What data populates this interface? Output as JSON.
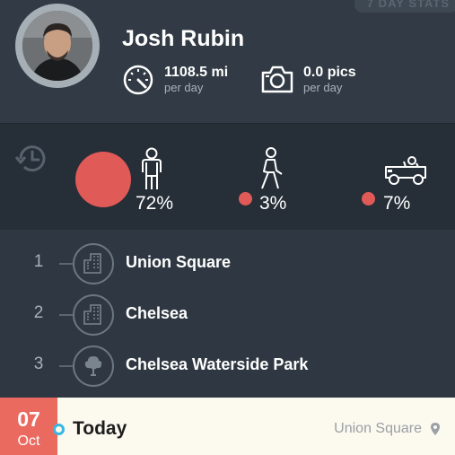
{
  "header": {
    "badge": "7 DAY STATS",
    "user_name": "Josh Rubin",
    "stats": {
      "distance_value": "1108.5 mi",
      "distance_unit": "per day",
      "photos_value": "0.0 pics",
      "photos_unit": "per day"
    }
  },
  "activity": {
    "standing_pct": "72%",
    "walking_pct": "3%",
    "driving_pct": "7%"
  },
  "places": [
    {
      "rank": "1",
      "name": "Union Square",
      "icon": "building-icon"
    },
    {
      "rank": "2",
      "name": "Chelsea",
      "icon": "building-icon"
    },
    {
      "rank": "3",
      "name": "Chelsea Waterside Park",
      "icon": "tree-icon"
    }
  ],
  "footer": {
    "day": "07",
    "month": "Oct",
    "today_label": "Today",
    "location": "Union Square"
  },
  "colors": {
    "accent_red": "#e05a57",
    "today_blue": "#37b7e3",
    "background": "#2f3842"
  }
}
